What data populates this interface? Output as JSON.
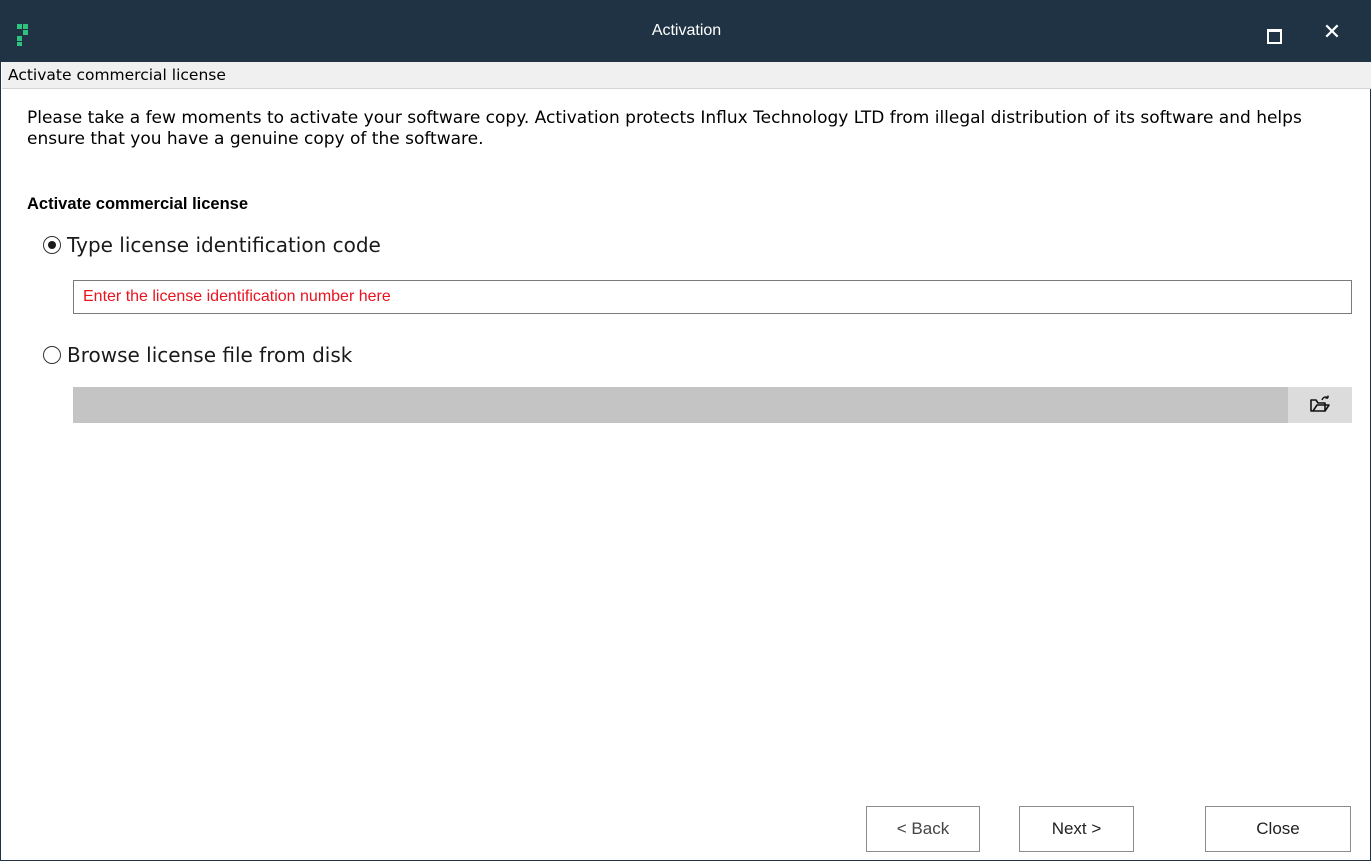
{
  "window": {
    "title": "Activation",
    "maximize_icon": "maximize-icon",
    "close_glyph": "✕"
  },
  "subheader": {
    "title": "Activate commercial license"
  },
  "description": "Please take a few moments to activate your software copy. Activation protects Influx Technology LTD from illegal distribution of its software and helps ensure that you have a genuine copy of the software.",
  "section": {
    "heading": "Activate commercial license",
    "options": [
      {
        "label": "Type license identification code",
        "selected": true
      },
      {
        "label": "Browse license file from disk",
        "selected": false
      }
    ]
  },
  "license_input": {
    "value": "",
    "placeholder": "Enter the license identification number here"
  },
  "file_picker": {
    "value": "",
    "icon": "folder-open-icon"
  },
  "buttons": {
    "back": "< Back",
    "next": "Next >",
    "close": "Close"
  },
  "colors": {
    "titlebar": "#1f3344",
    "logo_accent": "#2ec27e",
    "placeholder": "#e8131f",
    "file_field_disabled": "#c4c4c4"
  }
}
